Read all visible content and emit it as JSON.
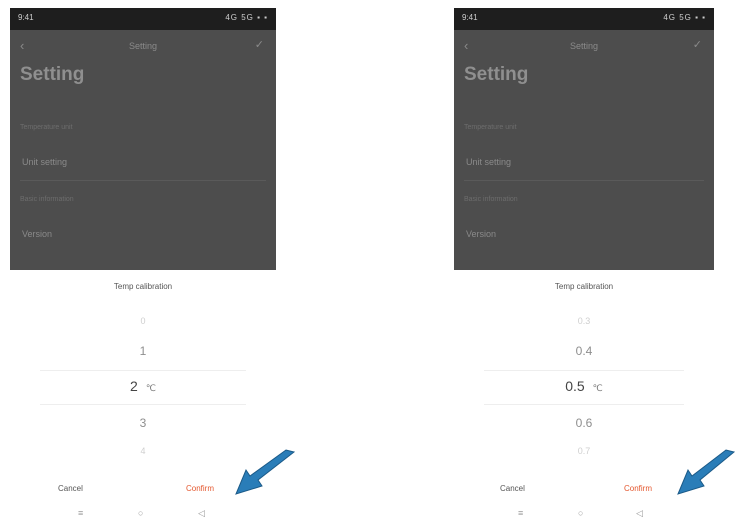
{
  "left": {
    "status": {
      "time": "9:41",
      "right": "4G 5G ▪ ▪"
    },
    "nav": {
      "back": "‹",
      "title": "Setting",
      "action": "✓"
    },
    "big_title": "Setting",
    "subtitle": "",
    "section1": "Temperature unit",
    "row1": {
      "label": "Unit setting",
      "value": ""
    },
    "section2": "Basic information",
    "row2": {
      "label": "Version",
      "value": ""
    },
    "picker": {
      "title": "Temp calibration",
      "items": [
        "0",
        "1",
        "2",
        "3",
        "4"
      ],
      "selected_index": 2,
      "unit": "℃"
    },
    "cancel": "Cancel",
    "confirm": "Confirm",
    "nav_keys": [
      "≡",
      "○",
      "◁"
    ]
  },
  "right": {
    "status": {
      "time": "9:41",
      "right": "4G 5G ▪ ▪"
    },
    "nav": {
      "back": "‹",
      "title": "Setting",
      "action": "✓"
    },
    "big_title": "Setting",
    "subtitle": "",
    "section1": "Temperature unit",
    "row1": {
      "label": "Unit setting",
      "value": ""
    },
    "section2": "Basic information",
    "row2": {
      "label": "Version",
      "value": ""
    },
    "picker": {
      "title": "Temp calibration",
      "items": [
        "0.3",
        "0.4",
        "0.5",
        "0.6",
        "0.7"
      ],
      "selected_index": 2,
      "unit": "℃"
    },
    "cancel": "Cancel",
    "confirm": "Confirm",
    "nav_keys": [
      "≡",
      "○",
      "◁"
    ]
  },
  "colors": {
    "accent": "#e4572e",
    "arrow": "#2a7db8",
    "overlay": "#4d4d4d"
  },
  "icons": [
    "back-chevron-icon",
    "check-icon",
    "menu-key-icon",
    "home-key-icon",
    "back-key-icon",
    "callout-arrow-icon"
  ]
}
